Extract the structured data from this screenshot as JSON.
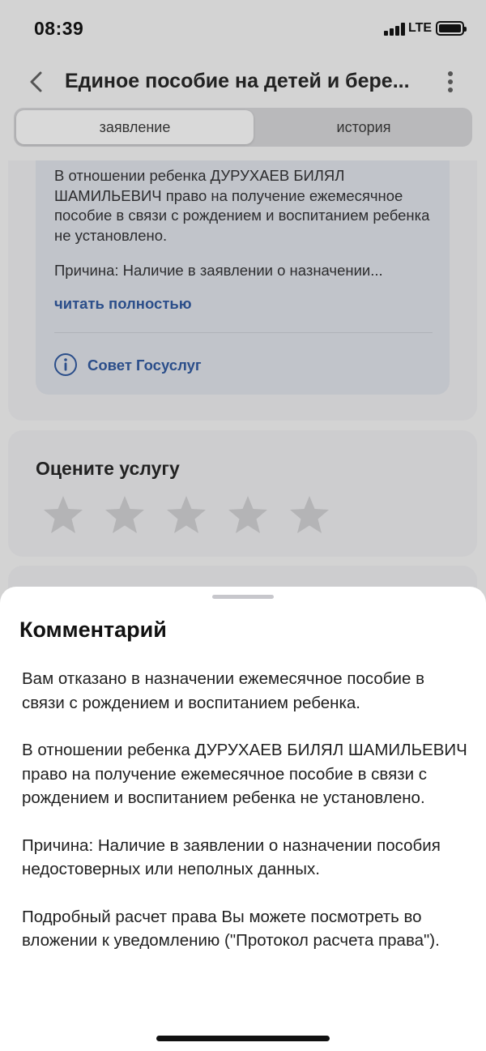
{
  "status_bar": {
    "time": "08:39",
    "network": "LTE"
  },
  "header": {
    "title": "Единое пособие на детей и бере..."
  },
  "tabs": [
    {
      "label": "заявление",
      "active": true
    },
    {
      "label": "история",
      "active": false
    }
  ],
  "notice_card": {
    "text": "В отношении ребенка ДУРУХАЕВ БИЛЯЛ ШАМИЛЬЕВИЧ право на получение ежемесячное пособие в связи с рождением и воспитанием ребенка не установлено.",
    "reason": "Причина: Наличие в заявлении о назначении...",
    "read_more": "читать полностью",
    "advice": "Совет Госуслуг"
  },
  "rating": {
    "title": "Оцените услугу",
    "stars": 5,
    "value": 0
  },
  "comment_sheet": {
    "title": "Комментарий",
    "paragraphs": [
      "Вам отказано в назначении ежемесячное пособие в связи с рождением и воспитанием ребенка.",
      "В отношении ребенка ДУРУХАЕВ БИЛЯЛ ШАМИЛЬЕВИЧ право на получение ежемесячное пособие в связи с рождением и воспитанием ребенка не установлено.",
      "Причина: Наличие в заявлении о назначении пособия недостоверных или неполных данных.",
      "Подробный расчет права Вы можете посмотреть во вложении к уведомлению (\"Протокол расчета права\")."
    ]
  },
  "colors": {
    "link": "#2b4e8a",
    "overlay": "#d3d3d3",
    "sheet": "#ffffff"
  },
  "icons": [
    "back-icon",
    "more-icon",
    "info-icon",
    "star-icon"
  ]
}
